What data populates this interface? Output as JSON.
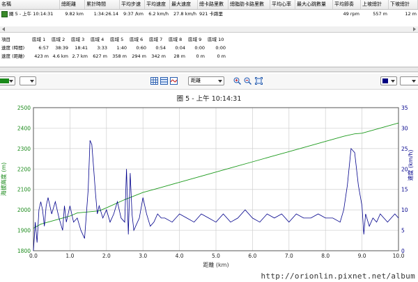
{
  "lap_table": {
    "headers": [
      "名稱",
      "總距離",
      "累計時間",
      "平均步速",
      "平均速度",
      "最大速度",
      "總卡路里數",
      "總脂肪卡路里數",
      "平均心率",
      "最大心跳數量",
      "平均節奏",
      "上坡總計",
      "下坡總計"
    ],
    "row": [
      "圈 5 - 上午 10:14:31",
      "9.82 km",
      "1:34:26.14",
      "9:37 /km",
      "6.2 km/h",
      "27.8 km/h",
      "921 卡路里",
      "",
      "",
      "",
      "49 rpm",
      "557 m",
      "12 m"
    ]
  },
  "zones": {
    "headers": [
      "項目",
      "區域 1",
      "區域 2",
      "區域 3",
      "區域 4",
      "區域 5",
      "區域 6",
      "區域 7",
      "區域 8",
      "區域 9",
      "區域 10"
    ],
    "rows": [
      [
        "速度 (時間)",
        "6:57",
        "38:39",
        "18:41",
        "3:33",
        "1:40",
        "0:60",
        "0:54",
        "0:04",
        "0:00",
        "0:00"
      ],
      [
        "速度 (距離)",
        "423 m",
        "4.6 km",
        "2.7 km",
        "627 m",
        "358 m",
        "294 m",
        "342 m",
        "28 m",
        "0 m",
        "0 m"
      ]
    ]
  },
  "toolbar": {
    "left_color": "#1a8a1a",
    "right_color": "#000080",
    "x_axis_select": "距離",
    "icons": [
      "grid-icon",
      "table-icon",
      "smooth-icon",
      "zoom-in-icon",
      "zoom-out-icon",
      "zoom-fit-icon"
    ]
  },
  "colors": {
    "altitude_line": "#1c9a1c",
    "speed_line": "#00008b",
    "left_axis_text": "#1a8a1a",
    "right_axis_text": "#00008b"
  },
  "chart_data": {
    "type": "line",
    "title": "圈 5 - 上午 10:14:31",
    "xlabel": "距離 (km)",
    "ylabel_left": "海拔高度 (m)",
    "ylabel_right": "速度 (km/h)",
    "xlim": [
      0,
      10
    ],
    "ylim_left": [
      1800,
      2500
    ],
    "ylim_right": [
      0,
      35
    ],
    "x_ticks": [
      "0.0",
      "1.0",
      "2.0",
      "3.0",
      "4.0",
      "5.0",
      "6.0",
      "7.0",
      "8.0",
      "9.0",
      "10.0"
    ],
    "y_left_ticks": [
      "1800",
      "1900",
      "2000",
      "2100",
      "2200",
      "2300",
      "2400",
      "2500"
    ],
    "y_right_ticks": [
      "0",
      "5",
      "10",
      "15",
      "20",
      "25",
      "30",
      "35"
    ],
    "grid": true,
    "series": [
      {
        "name": "",
        "axis": "left",
        "x": [
          0.0,
          0.2,
          0.5,
          0.8,
          1.0,
          1.2,
          1.5,
          1.8,
          2.0,
          2.5,
          3.0,
          3.5,
          4.0,
          4.5,
          5.0,
          5.5,
          6.0,
          6.5,
          7.0,
          7.5,
          8.0,
          8.5,
          8.8,
          9.0,
          9.5,
          10.0
        ],
        "values": [
          1910,
          1930,
          1945,
          1960,
          1970,
          1985,
          1990,
          1995,
          2010,
          2050,
          2085,
          2110,
          2135,
          2160,
          2185,
          2210,
          2235,
          2260,
          2285,
          2310,
          2335,
          2360,
          2372,
          2375,
          2400,
          2425
        ]
      },
      {
        "name": "",
        "axis": "right",
        "x": [
          0.0,
          0.05,
          0.1,
          0.15,
          0.2,
          0.25,
          0.3,
          0.35,
          0.4,
          0.5,
          0.6,
          0.7,
          0.8,
          0.85,
          0.9,
          1.0,
          1.1,
          1.2,
          1.3,
          1.4,
          1.5,
          1.55,
          1.6,
          1.65,
          1.7,
          1.75,
          1.8,
          1.9,
          2.0,
          2.1,
          2.2,
          2.3,
          2.4,
          2.5,
          2.55,
          2.6,
          2.65,
          2.7,
          2.75,
          2.8,
          2.9,
          3.0,
          3.1,
          3.2,
          3.3,
          3.4,
          3.5,
          3.6,
          3.8,
          4.0,
          4.2,
          4.4,
          4.6,
          4.8,
          5.0,
          5.2,
          5.4,
          5.6,
          5.8,
          6.0,
          6.2,
          6.4,
          6.6,
          6.8,
          7.0,
          7.2,
          7.4,
          7.6,
          7.8,
          8.0,
          8.2,
          8.4,
          8.5,
          8.6,
          8.7,
          8.8,
          8.9,
          9.0,
          9.05,
          9.1,
          9.2,
          9.3,
          9.4,
          9.5,
          9.6,
          9.7,
          9.8,
          9.9,
          10.0
        ],
        "values": [
          0,
          7,
          2,
          10,
          12,
          10,
          6,
          11,
          13,
          9,
          12,
          8,
          5,
          11,
          7,
          11,
          7,
          8,
          5,
          3,
          15,
          27,
          26,
          20,
          14,
          9,
          11,
          8,
          10,
          7,
          9,
          12,
          8,
          7,
          20,
          4,
          19,
          9,
          5,
          6,
          8,
          13,
          9,
          6,
          7,
          9,
          8,
          8,
          7,
          9,
          8,
          7,
          9,
          8,
          7,
          9,
          7,
          8,
          10,
          8,
          7,
          9,
          8,
          9,
          7,
          9,
          8,
          8,
          9,
          8,
          8,
          7,
          10,
          16,
          25,
          24,
          16,
          11,
          4,
          9,
          6,
          8,
          7,
          9,
          8,
          7,
          8,
          9,
          8
        ]
      }
    ]
  },
  "watermark": "http://orionlin.pixnet.net/album"
}
